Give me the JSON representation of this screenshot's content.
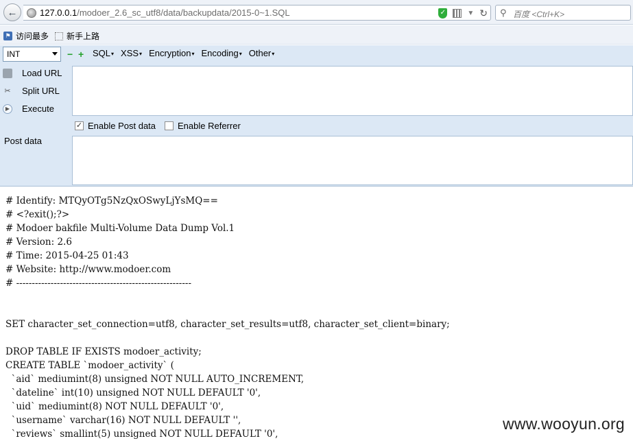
{
  "browser": {
    "url_host": "127.0.0.1",
    "url_path": "/modoer_2.6_sc_utf8/data/backupdata/2015-0~1.SQL",
    "search_placeholder": "百度 <Ctrl+K>"
  },
  "bookmarks": [
    "访问最多",
    "新手上路"
  ],
  "hackbar": {
    "select_value": "INT",
    "minus_label": "−",
    "plus_label": "+",
    "menus": [
      "SQL",
      "XSS",
      "Encryption",
      "Encoding",
      "Other"
    ],
    "actions": [
      "Load URL",
      "Split URL",
      "Execute"
    ],
    "enable_post_label": "Enable Post data",
    "enable_post_checked": true,
    "enable_referrer_label": "Enable Referrer",
    "enable_referrer_checked": false,
    "post_data_label": "Post data"
  },
  "content_lines": [
    "# Identify: MTQyOTg5NzQxOSwyLjYsMQ==",
    "# <?exit();?>",
    "# Modoer bakfile Multi-Volume Data Dump Vol.1",
    "# Version: 2.6",
    "# Time: 2015-04-25 01:43",
    "# Website: http://www.modoer.com",
    "# --------------------------------------------------------",
    "",
    "",
    "SET character_set_connection=utf8, character_set_results=utf8, character_set_client=binary;",
    "",
    "DROP TABLE IF EXISTS modoer_activity;",
    "CREATE TABLE `modoer_activity` (",
    "  `aid` mediumint(8) unsigned NOT NULL AUTO_INCREMENT,",
    "  `dateline` int(10) unsigned NOT NULL DEFAULT '0',",
    "  `uid` mediumint(8) NOT NULL DEFAULT '0',",
    "  `username` varchar(16) NOT NULL DEFAULT '',",
    "  `reviews` smallint(5) unsigned NOT NULL DEFAULT '0',"
  ],
  "watermark": "www.wooyun.org"
}
